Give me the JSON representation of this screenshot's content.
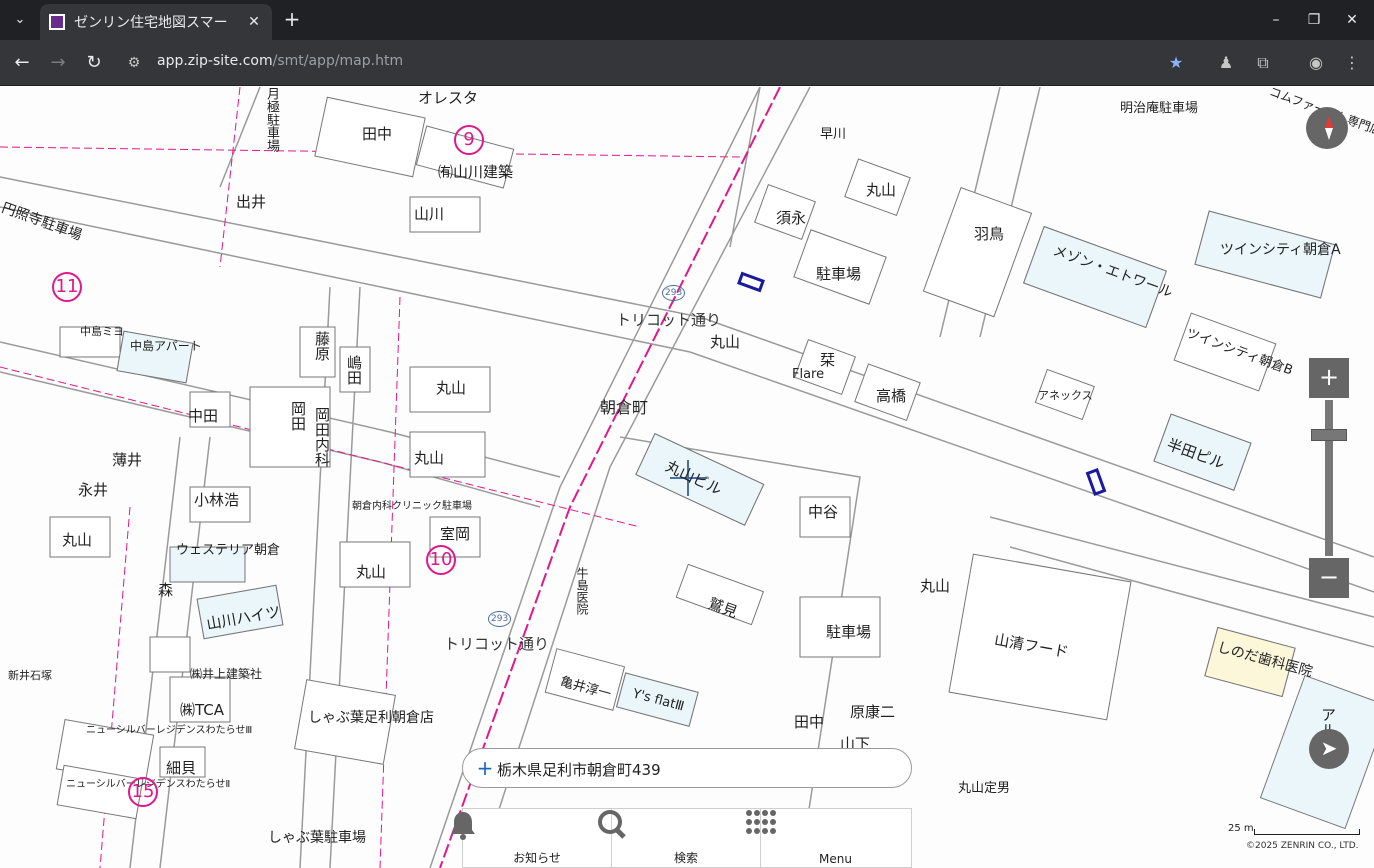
{
  "browser": {
    "tab_title": "ゼンリン住宅地図スマー",
    "url_host": "app.zip-site.com",
    "url_path": "/smt/app/map.htm"
  },
  "map": {
    "buildings": [
      "田中",
      "出井",
      "山川",
      "㈲山川建築",
      "丸山",
      "須永",
      "駐車場",
      "羽鳥",
      "早川",
      "明治庵駐車場",
      "コムファースト専門店街従業員用有料契約駐車場",
      "ツインシティ朝倉A",
      "メゾン・エトワール",
      "ツインシティ朝倉B",
      "アネックス",
      "半田ピル",
      "栞",
      "Flare",
      "高橋",
      "丸山",
      "藤原",
      "嶋田",
      "中島ミヨ",
      "中島アパート",
      "中田",
      "岡田",
      "岡田内科",
      "丸山",
      "丸山",
      "薄井",
      "永井",
      "小林浩",
      "ウェステリア朝倉",
      "森",
      "山川ハイツ",
      "丸山",
      "室岡",
      "丸山",
      "朝倉内科クリニック駐車場",
      "中谷",
      "鷲見",
      "丸山",
      "駐車場",
      "山清フード",
      "しのだ歯科医院",
      "亀井淳一",
      "Y's flatⅢ",
      "田中",
      "原康二",
      "丸山定男",
      "細貝",
      "㈱TCA",
      "㈱井上建築社",
      "しゃぶ葉足利朝倉店",
      "しゃぶ葉駐車場",
      "ニューシルバーレジデンスわたらせⅢ",
      "ニューシルバーレジデンスわたらせⅡ",
      "新井石塚",
      "牛島医院",
      "丸山ビル",
      "オレスタ",
      "アル",
      "山下",
      "円照寺駐車場",
      "月極駐車場"
    ],
    "streets": [
      "トリコット通り",
      "トリコット通り"
    ],
    "town": "朝倉町",
    "block_numbers": [
      "9",
      "11",
      "10",
      "15"
    ],
    "route_number": "293"
  },
  "controls": {
    "zoom_in": "+",
    "zoom_out": "−",
    "address": "栃木県足利市朝倉町439",
    "address_plus": "+"
  },
  "bottom_nav": [
    {
      "label": "お知らせ",
      "icon": "bell-icon"
    },
    {
      "label": "検索",
      "icon": "search-icon"
    },
    {
      "label": "Menu",
      "icon": "grid-icon"
    }
  ],
  "scale": "25 m",
  "copyright": "©2025 ZENRIN CO., LTD.",
  "colors": {
    "chrome_dark": "#202124",
    "chrome_toolbar": "#35363a",
    "map_pink": "#e0188c",
    "control_gray": "#666666"
  }
}
